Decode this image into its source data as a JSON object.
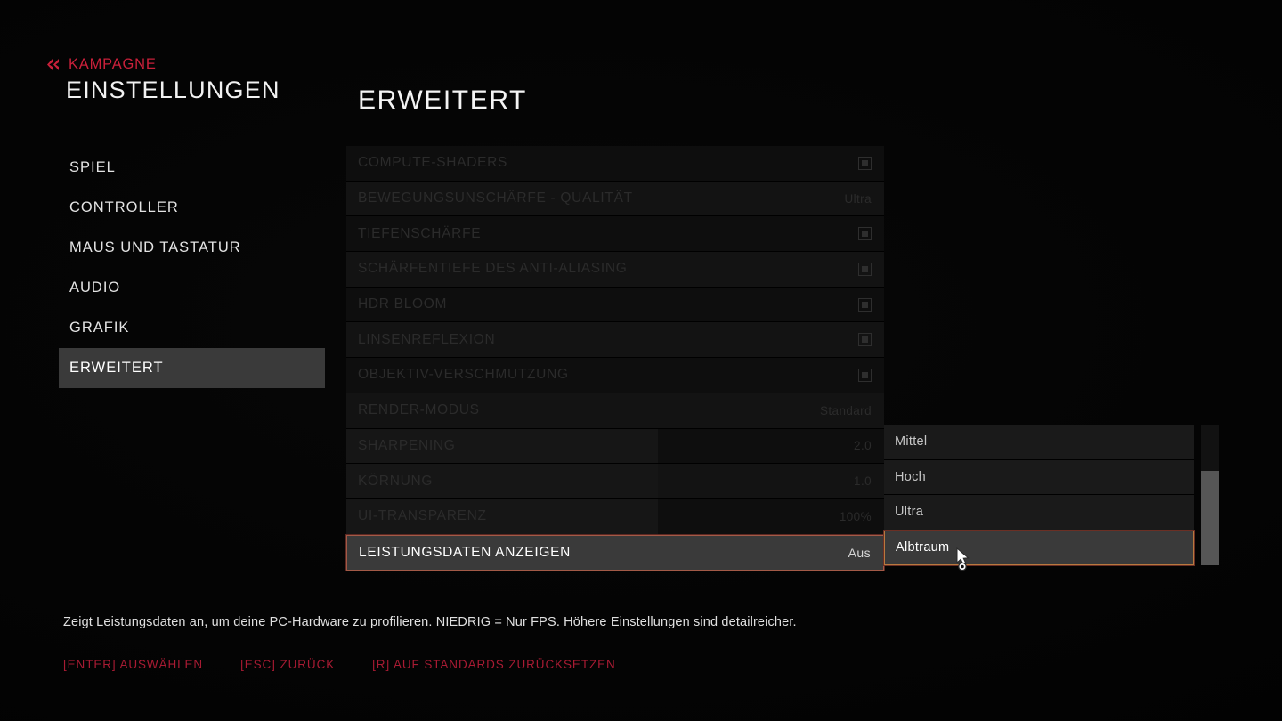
{
  "header": {
    "back_icon": "chevron-double-left-icon",
    "breadcrumb": "KAMPAGNE",
    "title": "EINSTELLUNGEN"
  },
  "accent": {
    "red": "#c9203a",
    "hint_red": "#a81b33",
    "select_border": "#b8793f",
    "row_highlight": "#3a3a3a"
  },
  "sidebar": {
    "items": [
      {
        "label": "SPIEL",
        "active": false
      },
      {
        "label": "CONTROLLER",
        "active": false
      },
      {
        "label": "MAUS UND TASTATUR",
        "active": false
      },
      {
        "label": "AUDIO",
        "active": false
      },
      {
        "label": "GRAFIK",
        "active": false
      },
      {
        "label": "ERWEITERT",
        "active": true
      }
    ]
  },
  "main": {
    "page_title": "ERWEITERT",
    "rows": [
      {
        "label": "COMPUTE-SHADERS",
        "type": "checkbox",
        "value": ""
      },
      {
        "label": "BEWEGUNGSUNSCHÄRFE - QUALITÄT",
        "type": "value",
        "value": "Ultra"
      },
      {
        "label": "TIEFENSCHÄRFE",
        "type": "checkbox",
        "value": ""
      },
      {
        "label": "SCHÄRFENTIEFE DES ANTI-ALIASING",
        "type": "checkbox",
        "value": ""
      },
      {
        "label": "HDR BLOOM",
        "type": "checkbox",
        "value": ""
      },
      {
        "label": "LINSENREFLEXION",
        "type": "checkbox",
        "value": ""
      },
      {
        "label": "OBJEKTIV-VERSCHMUTZUNG",
        "type": "checkbox",
        "value": ""
      },
      {
        "label": "RENDER-MODUS",
        "type": "value",
        "value": "Standard"
      },
      {
        "label": "SHARPENING",
        "type": "slider",
        "value": "2.0",
        "fill_pct": 58
      },
      {
        "label": "KÖRNUNG",
        "type": "slider",
        "value": "1.0",
        "fill_pct": 58
      },
      {
        "label": "UI-TRANSPARENZ",
        "type": "slider",
        "value": "100%",
        "fill_pct": 58
      },
      {
        "label": "LEISTUNGSDATEN ANZEIGEN",
        "type": "value",
        "value": "Aus",
        "selected": true
      }
    ]
  },
  "dropdown": {
    "options": [
      {
        "label": "Mittel",
        "selected": false
      },
      {
        "label": "Hoch",
        "selected": false
      },
      {
        "label": "Ultra",
        "selected": false
      },
      {
        "label": "Albtraum",
        "selected": true
      }
    ],
    "scroll_thumb_top_pct": 33,
    "scroll_thumb_height_pct": 67
  },
  "footer": {
    "description": "Zeigt Leistungsdaten an, um deine PC-Hardware zu profilieren. NIEDRIG = Nur FPS. Höhere Einstellungen sind detailreicher.",
    "hints": [
      "[ENTER] AUSWÄHLEN",
      "[ESC] ZURÜCK",
      "[r] AUF STANDARDS ZURÜCKSETZEN"
    ]
  },
  "cursor": {
    "icon": "mouse-pointer-icon"
  }
}
